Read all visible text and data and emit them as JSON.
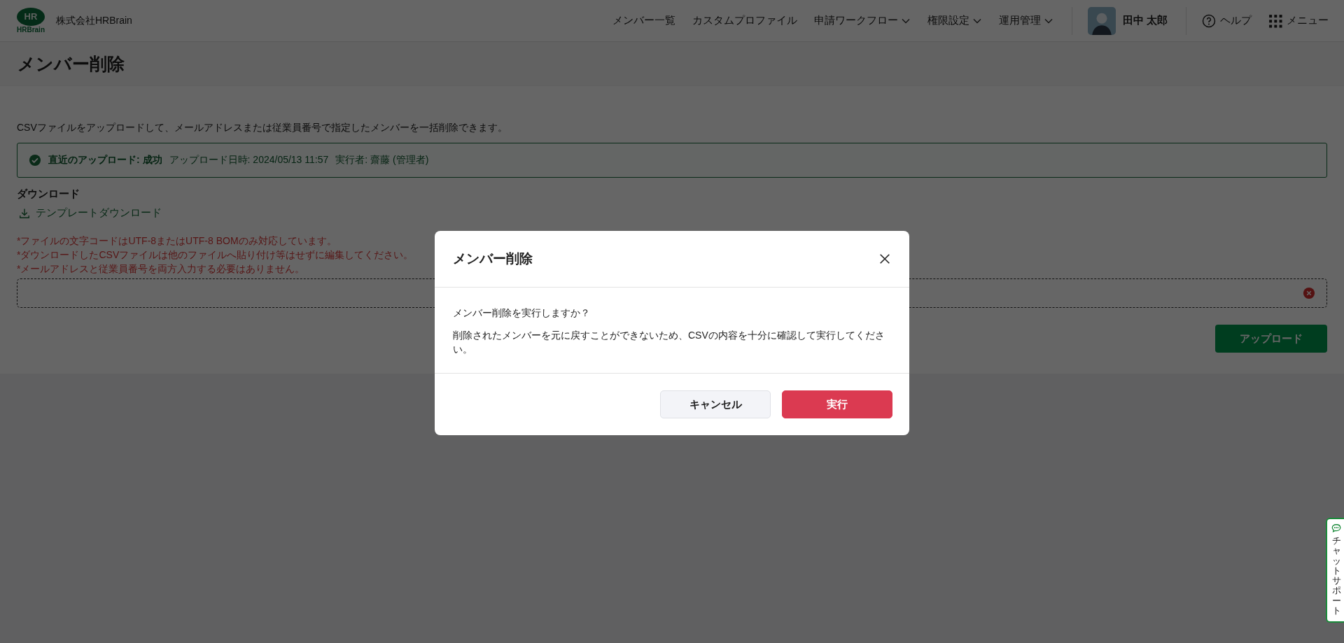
{
  "header": {
    "logo_mark": "HR",
    "logo_text": "HRBrain",
    "company": "株式会社HRBrain",
    "nav": [
      {
        "label": "メンバー一覧",
        "dropdown": false
      },
      {
        "label": "カスタムプロファイル",
        "dropdown": false
      },
      {
        "label": "申請ワークフロー",
        "dropdown": true
      },
      {
        "label": "権限設定",
        "dropdown": true
      },
      {
        "label": "運用管理",
        "dropdown": true
      }
    ],
    "user": {
      "name": "田中 太郎"
    },
    "help": "ヘルプ",
    "menu": "メニュー"
  },
  "page": {
    "title": "メンバー削除",
    "description": "CSVファイルをアップロードして、メールアドレスまたは従業員番号で指定したメンバーを一括削除できます。",
    "upload_status": {
      "success": true,
      "label": "直近のアップロード: 成功",
      "date": "アップロード日時: 2024/05/13 11:57",
      "actor": "実行者: 齋藤 (管理者)"
    },
    "download": {
      "heading": "ダウンロード",
      "link": "テンプレートダウンロード"
    },
    "notes": [
      "*ファイルの文字コードはUTF-8またはUTF-8 BOMのみ対応しています。",
      "*ダウンロードしたCSVファイルは他のファイルへ貼り付け等はせずに編集してください。",
      "*メールアドレスと従業員番号を両方入力する必要はありません。"
    ],
    "upload_button": "アップロード"
  },
  "dialog": {
    "title": "メンバー削除",
    "message": "メンバー削除を実行しますか？",
    "warning": "削除されたメンバーを元に戻すことができないため、CSVの内容を十分に確認して実行してください。",
    "buttons": [
      {
        "label": "キャンセル",
        "kind": "secondary"
      },
      {
        "label": "実行",
        "kind": "danger"
      }
    ]
  },
  "chat_support": {
    "label": "チャットサポート"
  }
}
